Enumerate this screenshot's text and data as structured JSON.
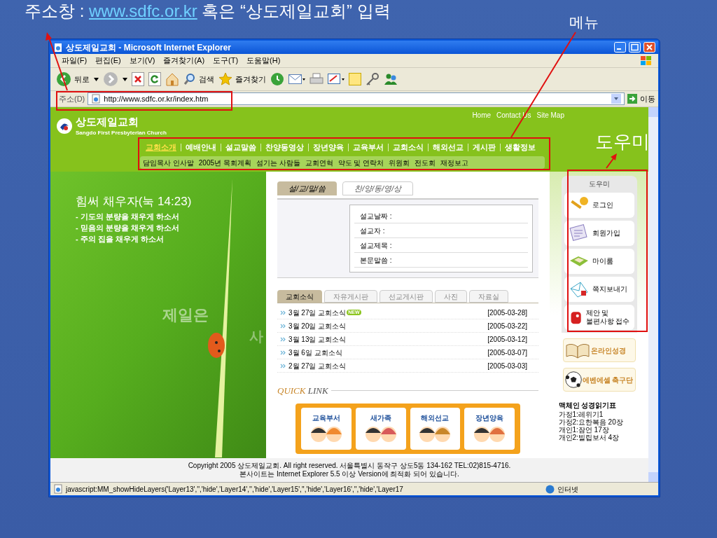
{
  "annotations": {
    "address_note": {
      "prefix": "주소창 : ",
      "link": "www.sdfc.or.kr",
      "suffix": " 혹은 “상도제일교회” 입력"
    },
    "menu_label": "메뉴",
    "helper_label": "도우미"
  },
  "window": {
    "title": "상도제일교회 - Microsoft Internet Explorer"
  },
  "menu_bar": [
    "파일(F)",
    "편집(E)",
    "보기(V)",
    "즐겨찾기(A)",
    "도구(T)",
    "도움말(H)"
  ],
  "toolbar": {
    "back": "뒤로",
    "search": "검색",
    "favorites": "즐겨찾기"
  },
  "address_bar": {
    "label": "주소(D)",
    "value": "http://www.sdfc.or.kr/index.htm",
    "go": "이동"
  },
  "site_header": {
    "logo_text": "상도제일교회",
    "logo_sub": "Sangdo First Presbyterian Church",
    "top_links": [
      "Home",
      "Contact Us",
      "Site Map"
    ]
  },
  "main_nav": [
    {
      "label": "교회소개",
      "selected": true
    },
    {
      "label": "예배안내",
      "selected": false
    },
    {
      "label": "설교말씀",
      "selected": false
    },
    {
      "label": "찬양동영상",
      "selected": false
    },
    {
      "label": "장년양육",
      "selected": false
    },
    {
      "label": "교육부서",
      "selected": false
    },
    {
      "label": "교회소식",
      "selected": false
    },
    {
      "label": "해외선교",
      "selected": false
    },
    {
      "label": "게시판",
      "selected": false
    },
    {
      "label": "생활정보",
      "selected": false
    }
  ],
  "sub_nav": [
    "담임목사 인사말",
    "2005년 목회계획",
    "섬기는 사람들",
    "교회연혁",
    "약도 및 연락처",
    "위원회",
    "전도회",
    "재정보고"
  ],
  "banner": {
    "title": "힘써 채우자(눅 14:23)",
    "lines": [
      "- 기도의 분량을 채우게 하소서",
      "- 믿음의 분량을 채우게 하소서",
      "- 주의 집을 채우게 하소서"
    ],
    "faded_texts": [
      "제일은",
      "사"
    ]
  },
  "sermon": {
    "tabs": [
      {
        "label": "설/교/말/씀",
        "selected": true
      },
      {
        "label": "찬/양/동/영/상",
        "selected": false
      }
    ],
    "fields": [
      "설교날짜 :",
      "설교자 :",
      "설교제목 :",
      "본문말씀 :"
    ]
  },
  "board": {
    "tabs": [
      {
        "label": "교회소식",
        "selected": true
      },
      {
        "label": "자유게시판",
        "selected": false
      },
      {
        "label": "선교게시판",
        "selected": false
      },
      {
        "label": "사진",
        "selected": false
      },
      {
        "label": "자료실",
        "selected": false
      }
    ],
    "posts": [
      {
        "title": "3월 27일 교회소식",
        "badge": "NEW",
        "date": "[2005-03-28]"
      },
      {
        "title": "3월 20일 교회소식",
        "date": "[2005-03-22]"
      },
      {
        "title": "3월 13일 교회소식",
        "date": "[2005-03-12]"
      },
      {
        "title": "3월 6일 교회소식",
        "date": "[2005-03-07]"
      },
      {
        "title": "2월 27일 교회소식",
        "date": "[2005-03-03]"
      }
    ]
  },
  "quick_link": {
    "title_a": "QUICK",
    "title_b": "LINK",
    "items": [
      "교육부서",
      "새가족",
      "해외선교",
      "장년양육"
    ]
  },
  "helper": {
    "title": "도우미",
    "items": [
      {
        "kind": "key",
        "lines": [
          "로그인"
        ]
      },
      {
        "kind": "form",
        "lines": [
          "회원가입"
        ]
      },
      {
        "kind": "box",
        "lines": [
          "마이룸"
        ]
      },
      {
        "kind": "mail",
        "lines": [
          "쪽지보내기"
        ]
      },
      {
        "kind": "postbox",
        "lines": [
          "제안 및",
          "불편사항 접수"
        ]
      }
    ]
  },
  "side_banners": [
    {
      "kind": "book",
      "label": "온라인성경"
    },
    {
      "kind": "ball",
      "label": "에벤에셀 축구단"
    }
  ],
  "reading_plan": {
    "title": "맥체인 성경읽기표",
    "lines": [
      "가정1:레위기1",
      "가정2:요한복음 20장",
      "개인1:잠언 17장",
      "개인2:빌립보서 4장"
    ]
  },
  "footer": [
    "Copyright 2005 상도제일교회. All right reserved. 서울특별시 동작구 상도5동 134-162 TEL:02)815-4716.",
    "본사이트는 Internet Explorer 5.5 이상 Version에 최적화 되어 있습니다."
  ],
  "status_bar": {
    "text": "javascript:MM_showHideLayers('Layer13','','hide','Layer14','','hide','Layer15','','hide','Layer16','','hide','Layer17",
    "zone": "인터넷"
  }
}
